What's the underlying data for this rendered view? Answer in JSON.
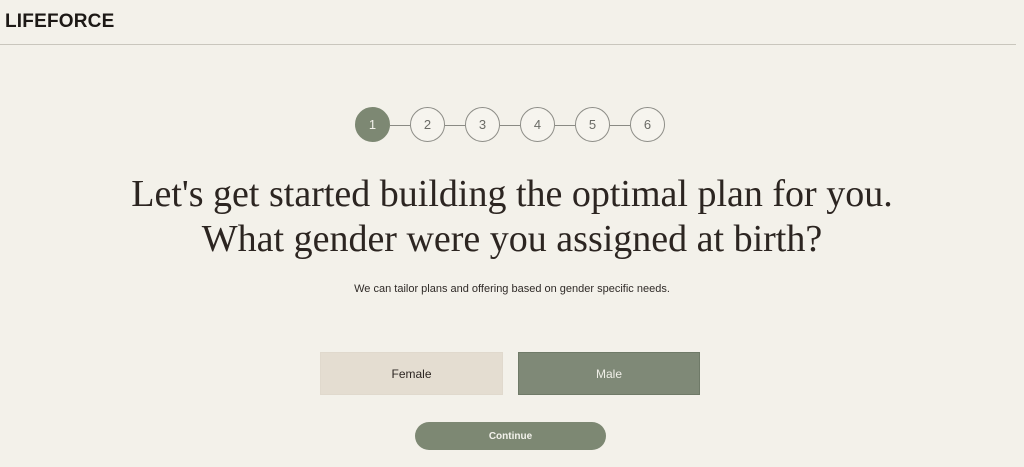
{
  "brand": {
    "name": "LIFEFORCE"
  },
  "stepper": {
    "steps": [
      "1",
      "2",
      "3",
      "4",
      "5",
      "6"
    ],
    "current_step": 1,
    "total_steps": 6
  },
  "question": {
    "line1": "Let's get started building the optimal plan for you.",
    "line2": "What gender were you assigned at birth?",
    "subtext": "We can tailor plans and offering based on gender specific needs."
  },
  "options": [
    {
      "label": "Female",
      "selected": false
    },
    {
      "label": "Male",
      "selected": true
    }
  ],
  "actions": {
    "continue_label": "Continue"
  },
  "colors": {
    "background": "#f3f1ea",
    "accent": "#7d8873",
    "option_unselected": "#e4ddd1",
    "text": "#2c2521"
  }
}
